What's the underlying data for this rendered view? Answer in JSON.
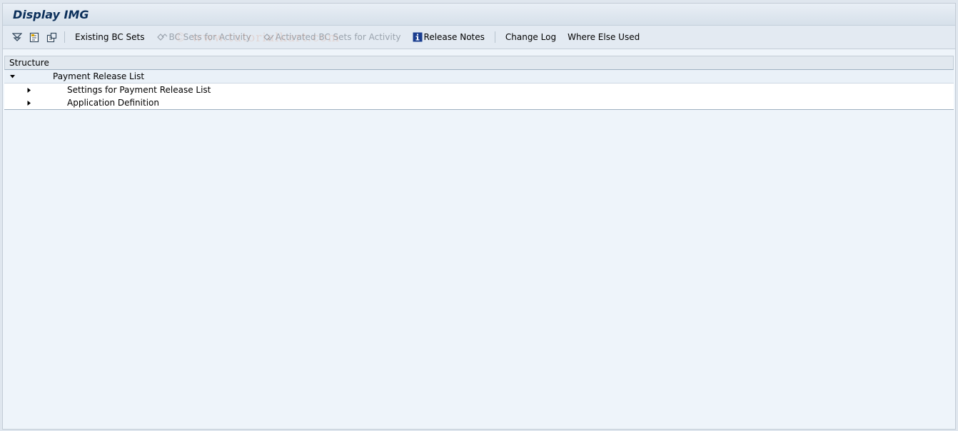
{
  "window": {
    "title": "Display IMG"
  },
  "toolbar": {
    "icons": [
      "expand-subtree-icon",
      "find-icon",
      "bookmark-icon"
    ],
    "existing_bc_sets": "Existing BC Sets",
    "bc_sets_for_activity": "BC Sets for Activity",
    "activated_bc_sets_for_activity": "Activated BC Sets for Activity",
    "release_notes": "Release Notes",
    "change_log": "Change Log",
    "where_else_used": "Where Else Used"
  },
  "watermark": "© www.tutorialkart.com",
  "tree": {
    "column_header": "Structure",
    "root": {
      "label": "Payment Release List",
      "expanded": true
    },
    "children": [
      {
        "label": "Settings for Payment Release List",
        "expanded": false
      },
      {
        "label": "Application Definition",
        "expanded": false
      }
    ]
  },
  "colors": {
    "background": "#eef4fa",
    "title": "#0b2f5a",
    "disabled_text": "#9aa3ad",
    "info_icon": "#1a3d8f"
  }
}
